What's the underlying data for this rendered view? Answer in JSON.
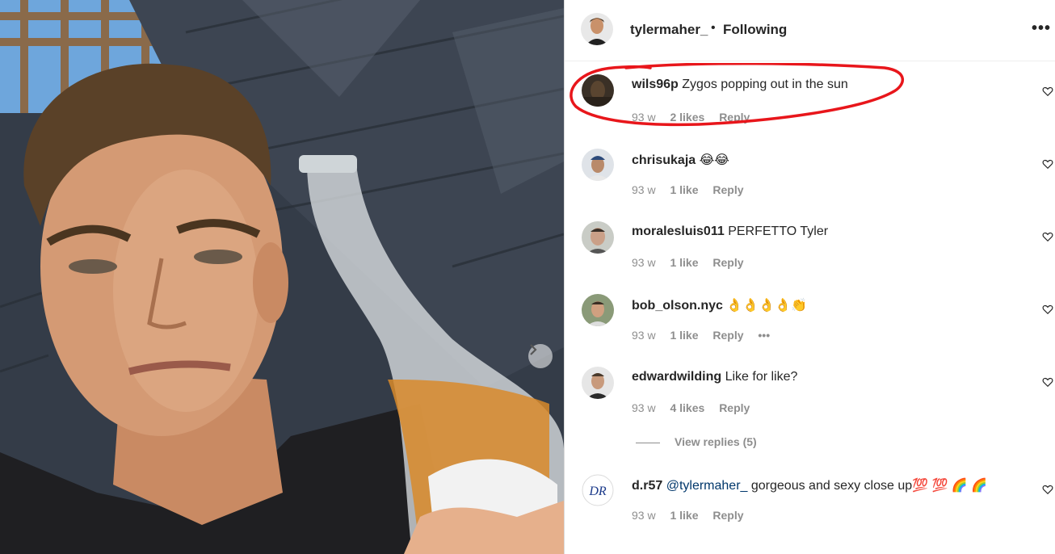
{
  "header": {
    "username": "tylermaher_",
    "separator": "•",
    "follow_status": "Following",
    "more_label": "•••"
  },
  "comments": [
    {
      "username": "wils96p",
      "text": "Zygos popping out in the sun",
      "age": "93 w",
      "likes": "2 likes",
      "reply": "Reply",
      "avatar_color": "#3a3026"
    },
    {
      "username": "chrisukaja",
      "text": "😂😂",
      "age": "93 w",
      "likes": "1 like",
      "reply": "Reply",
      "avatar_color": "#6f7d8c"
    },
    {
      "username": "moralesluis011",
      "text": "PERFETTO Tyler",
      "age": "93 w",
      "likes": "1 like",
      "reply": "Reply",
      "avatar_color": "#8a8f86"
    },
    {
      "username": "bob_olson.nyc",
      "text": "👌👌👌👌👏",
      "age": "93 w",
      "likes": "1 like",
      "reply": "Reply",
      "more": "•••",
      "avatar_color": "#7a8a6a"
    },
    {
      "username": "edwardwilding",
      "text": "Like for like?",
      "age": "93 w",
      "likes": "4 likes",
      "reply": "Reply",
      "avatar_color": "#4e4a47"
    },
    {
      "username": "d.r57",
      "mention": "@tylermaher_",
      "text": "gorgeous and sexy close up💯 💯 🌈 🌈",
      "age": "93 w",
      "likes": "1 like",
      "reply": "Reply",
      "avatar_text": "DR",
      "avatar_color": "#1b3a8a"
    }
  ],
  "view_replies": "View replies (5)",
  "colors": {
    "annotation": "#e8161b",
    "meta": "#8e8e8e",
    "text": "#262626"
  }
}
